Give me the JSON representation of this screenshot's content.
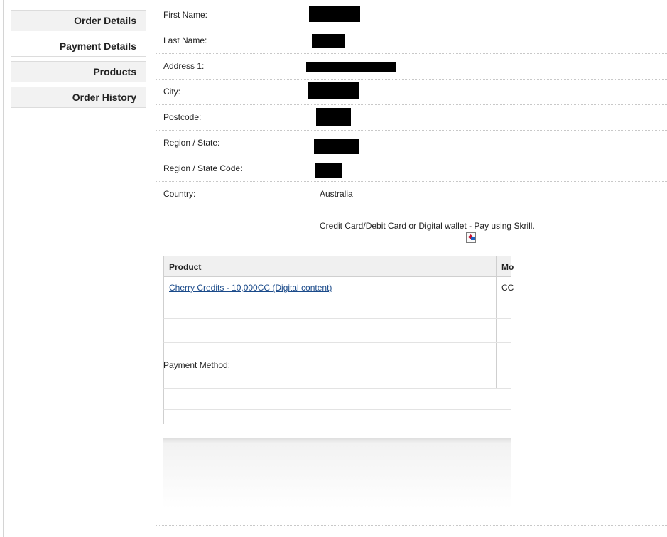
{
  "tabs": [
    {
      "label": "Order Details",
      "active": false
    },
    {
      "label": "Payment Details",
      "active": true
    },
    {
      "label": "Products",
      "active": false
    },
    {
      "label": "Order History",
      "active": false
    }
  ],
  "fields": [
    {
      "label": "First Name:",
      "redacted": true
    },
    {
      "label": "Last Name:",
      "redacted": true
    },
    {
      "label": "Address 1:",
      "redacted": true
    },
    {
      "label": "City:",
      "redacted": true
    },
    {
      "label": "Postcode:",
      "redacted": true
    },
    {
      "label": "Region / State:",
      "redacted": true
    },
    {
      "label": "Region / State Code:",
      "redacted": true
    },
    {
      "label": "Country:",
      "value": "Australia"
    }
  ],
  "payment": {
    "label": "Payment Method:",
    "description": "Credit Card/Debit Card or Digital wallet - Pay using Skrill.",
    "icon": "skrill-logo-icon",
    "table": {
      "columns": [
        "Product",
        "Mo"
      ],
      "rows": [
        {
          "product": "Cherry Credits - 10,000CC (Digital content)",
          "code": "CC"
        }
      ]
    }
  },
  "colors": {
    "link": "#1a4a8a",
    "redaction": "#000000",
    "tab_bg": "#f2f2f2"
  }
}
